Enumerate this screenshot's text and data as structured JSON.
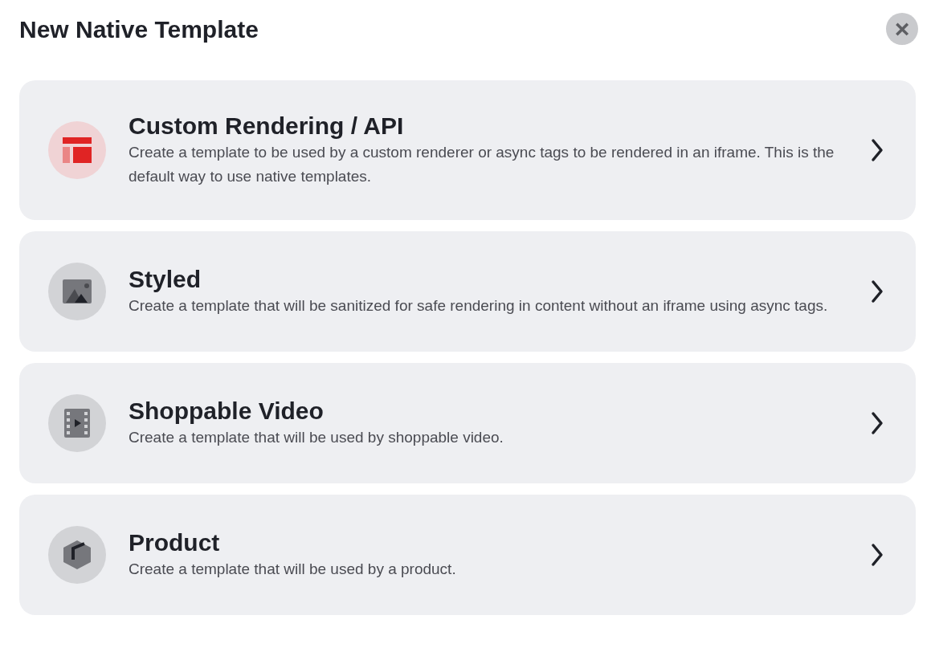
{
  "dialog": {
    "title": "New Native Template",
    "close_label": "×"
  },
  "options": [
    {
      "kind": "layout",
      "title": "Custom Rendering / API",
      "description": "Create a template to be used by a custom renderer or async tags to be rendered in an iframe. This is the default way to use native templates."
    },
    {
      "kind": "image",
      "title": "Styled",
      "description": "Create a template that will be sanitized for safe rendering in content without an iframe using async tags."
    },
    {
      "kind": "video",
      "title": "Shoppable Video",
      "description": "Create a template that will be used by shoppable video."
    },
    {
      "kind": "box",
      "title": "Product",
      "description": "Create a template that will be used by a product."
    }
  ]
}
